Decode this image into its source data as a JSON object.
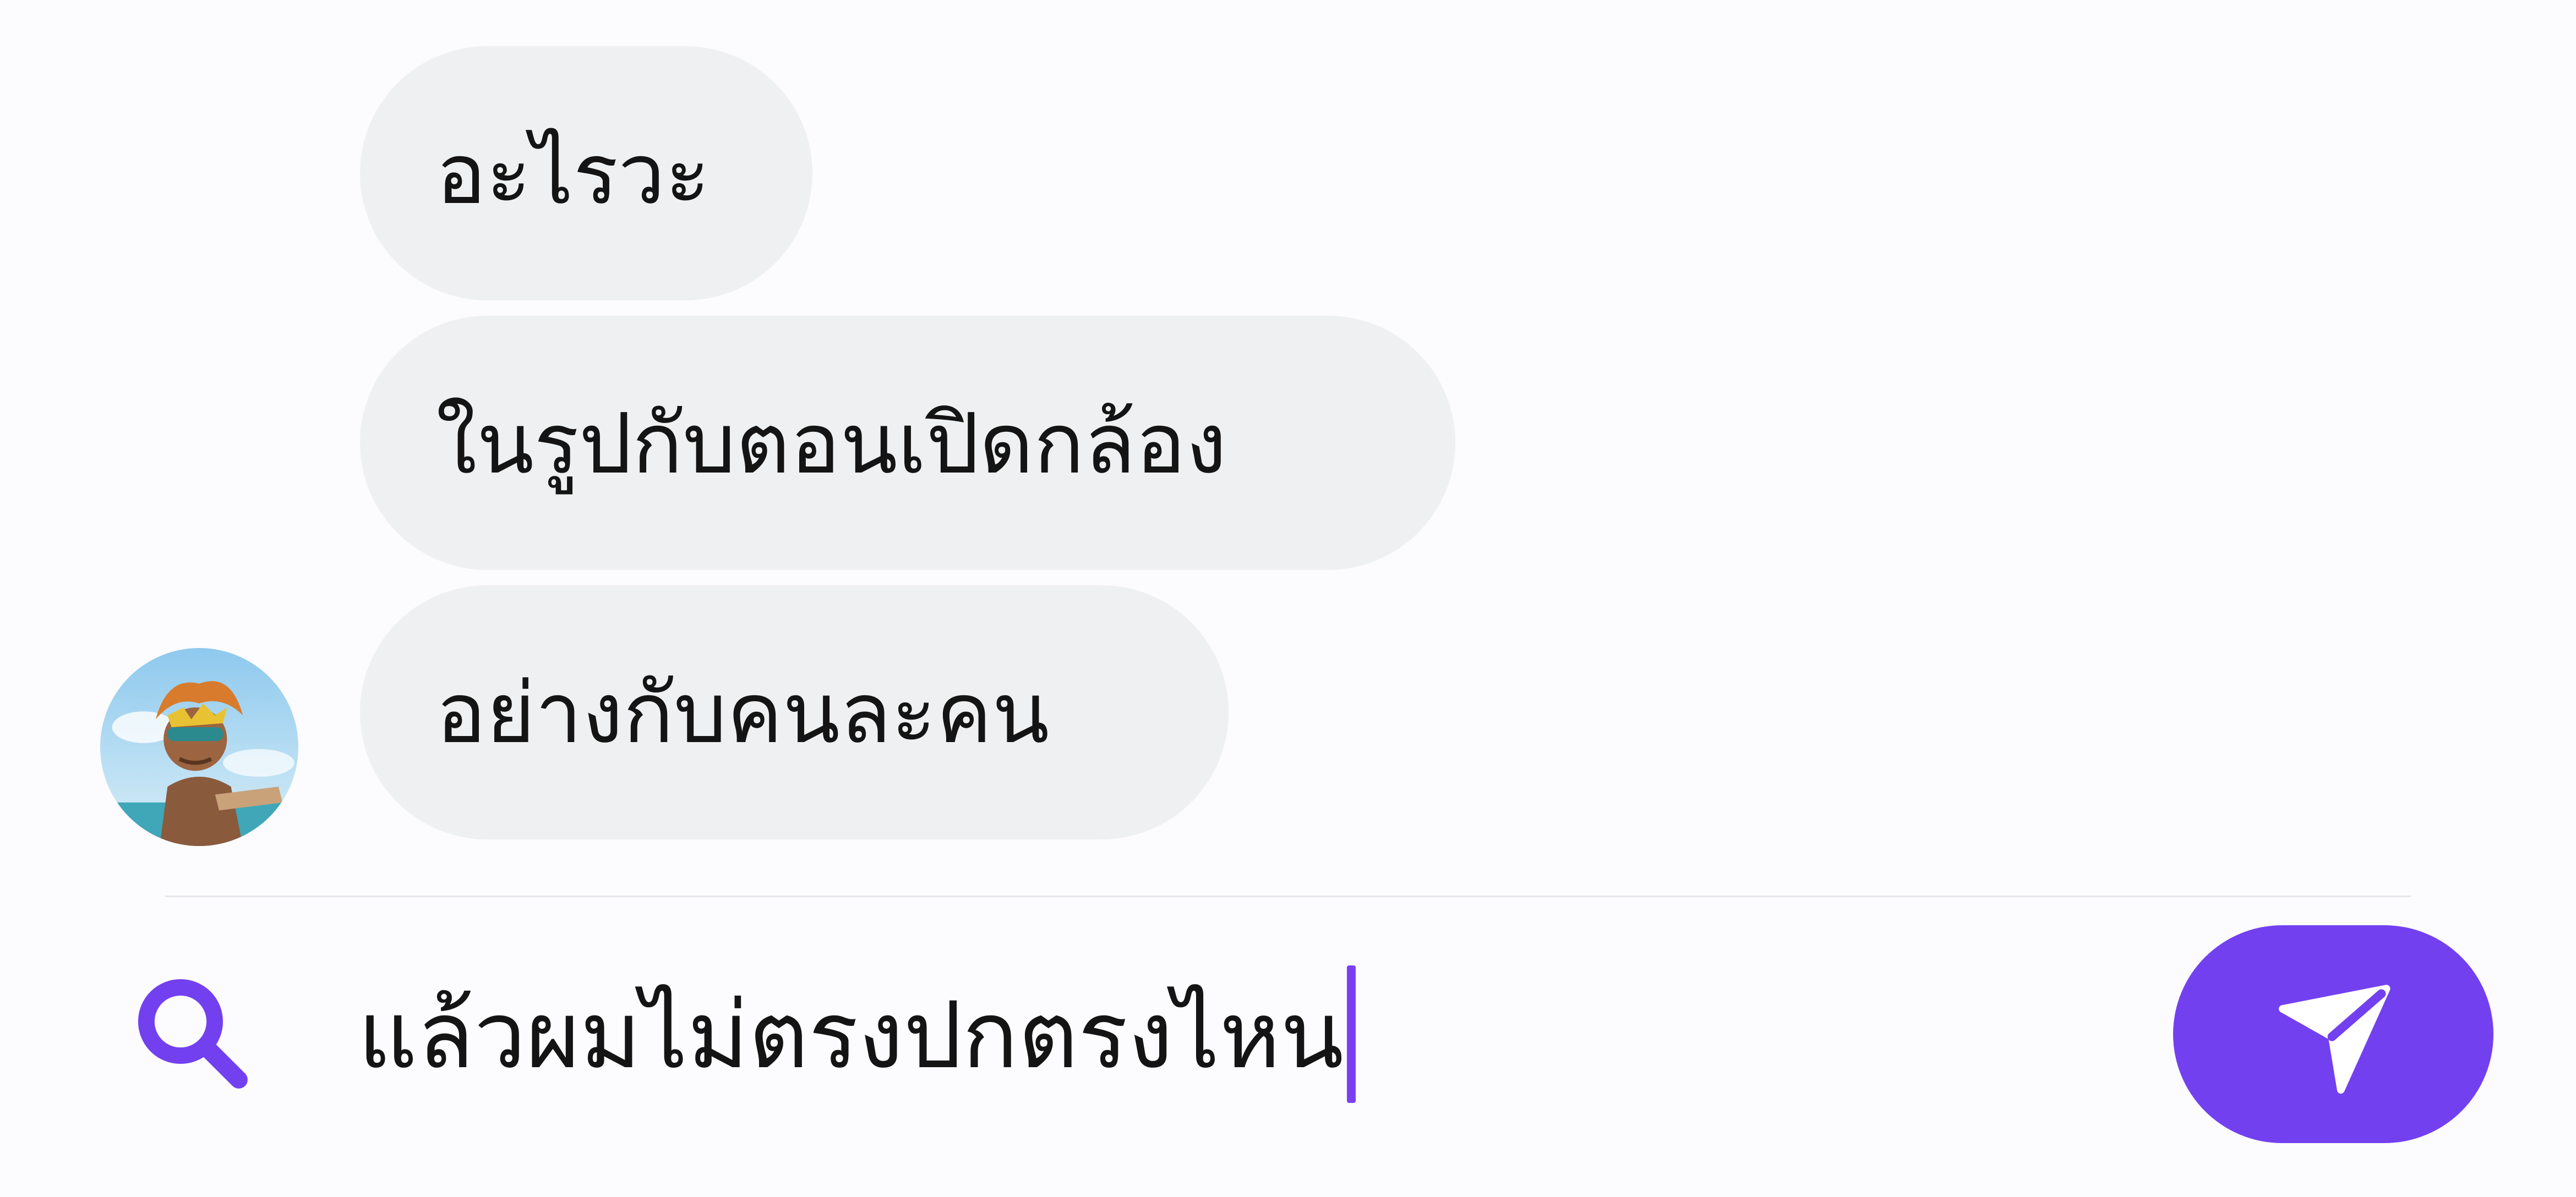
{
  "chat": {
    "messages": [
      {
        "text": "อะไรวะ"
      },
      {
        "text": "ในรูปกับตอนเปิดกล้อง"
      },
      {
        "text": "อย่างกับคนละคน"
      }
    ],
    "avatar": {
      "icon": "user-avatar"
    }
  },
  "composer": {
    "search_icon": "search-icon",
    "input_value": "แล้วผมไม่ตรงปกตรงไหน",
    "send_icon": "send-icon"
  },
  "colors": {
    "accent": "#7340f0",
    "bubble_bg": "#eff0f1",
    "background": "#fcfbfd",
    "text": "#141414"
  }
}
